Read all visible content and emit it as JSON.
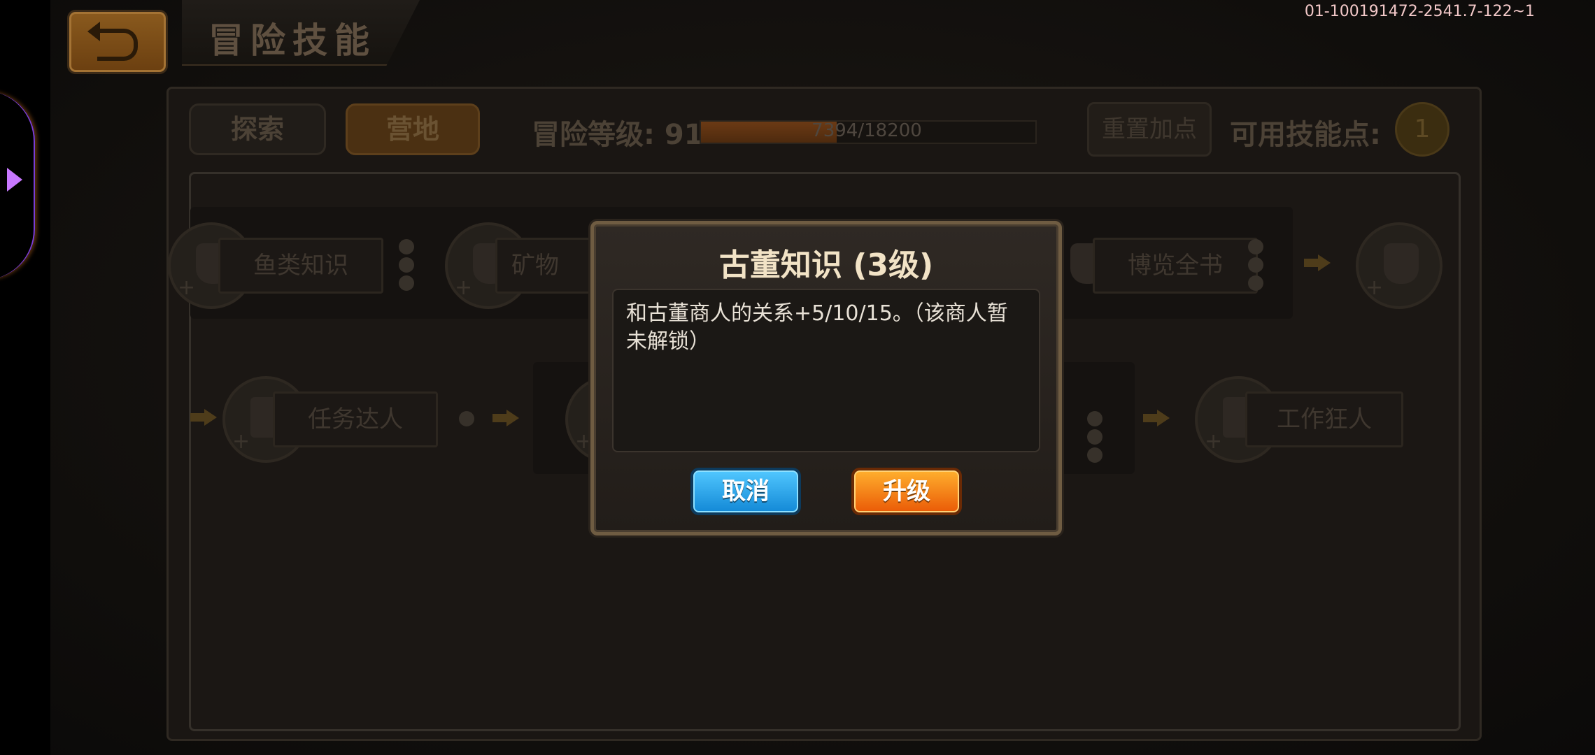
{
  "header": {
    "title": "冒险技能",
    "debug_id": "01-100191472-2541.7-122~1"
  },
  "tabs": [
    {
      "label": "探索",
      "active": false
    },
    {
      "label": "营地",
      "active": true
    }
  ],
  "level": {
    "label": "冒险等级: 91",
    "progress_text": "7394/18200",
    "progress_fraction": 0.406
  },
  "reset_button": "重置加点",
  "skill_points": {
    "label": "可用技能点:",
    "value": "1"
  },
  "skills_row1": [
    {
      "name": "鱼类知识"
    },
    {
      "name": "矿物"
    },
    {
      "name": "博览全书"
    }
  ],
  "skills_row2": [
    {
      "name": "任务达人"
    },
    {
      "name": "工作狂人"
    }
  ],
  "dialog": {
    "title": "古董知识 (3级)",
    "description": "和古董商人的关系+5/10/15。（该商人暂未解锁）",
    "cancel_label": "取消",
    "upgrade_label": "升级"
  },
  "colors": {
    "cancel_button": "#1f9ae6",
    "upgrade_button": "#f67d12",
    "dialog_title": "#f2e3c6"
  }
}
